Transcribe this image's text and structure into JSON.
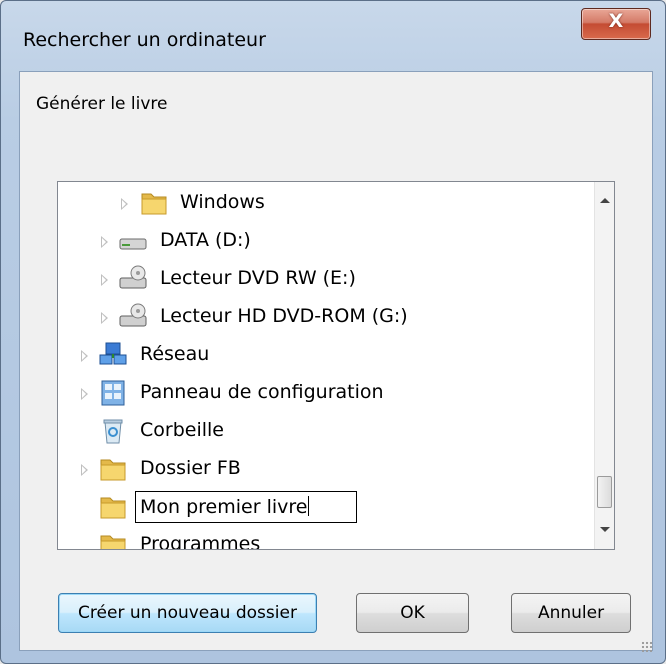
{
  "window": {
    "title": "Rechercher un ordinateur",
    "close_label": "X"
  },
  "instruction": "Générer le livre",
  "tree": {
    "items": [
      {
        "label": "Windows",
        "icon": "folder-icon",
        "expandable": true
      },
      {
        "label": "DATA (D:)",
        "icon": "drive-icon",
        "expandable": true
      },
      {
        "label": "Lecteur DVD RW (E:)",
        "icon": "dvd-drive-icon",
        "expandable": true
      },
      {
        "label": "Lecteur HD DVD-ROM (G:)",
        "icon": "dvd-drive-icon",
        "expandable": true
      },
      {
        "label": "Réseau",
        "icon": "network-icon",
        "expandable": true
      },
      {
        "label": "Panneau de configuration",
        "icon": "control-panel-icon",
        "expandable": true
      },
      {
        "label": "Corbeille",
        "icon": "recycle-bin-icon",
        "expandable": false
      },
      {
        "label": "Dossier FB",
        "icon": "folder-icon",
        "expandable": true
      },
      {
        "label": "Mon premier livre",
        "icon": "folder-icon",
        "expandable": false,
        "editing": true
      },
      {
        "label": "Programmes",
        "icon": "folder-icon",
        "expandable": false
      }
    ]
  },
  "buttons": {
    "new_folder": "Créer un nouveau dossier",
    "ok": "OK",
    "cancel": "Annuler"
  },
  "colors": {
    "title_bar": "#b9cde4",
    "close_button": "#c44c33",
    "focused_button": "#bee6fd",
    "dialog_body": "#f0f0f0"
  }
}
